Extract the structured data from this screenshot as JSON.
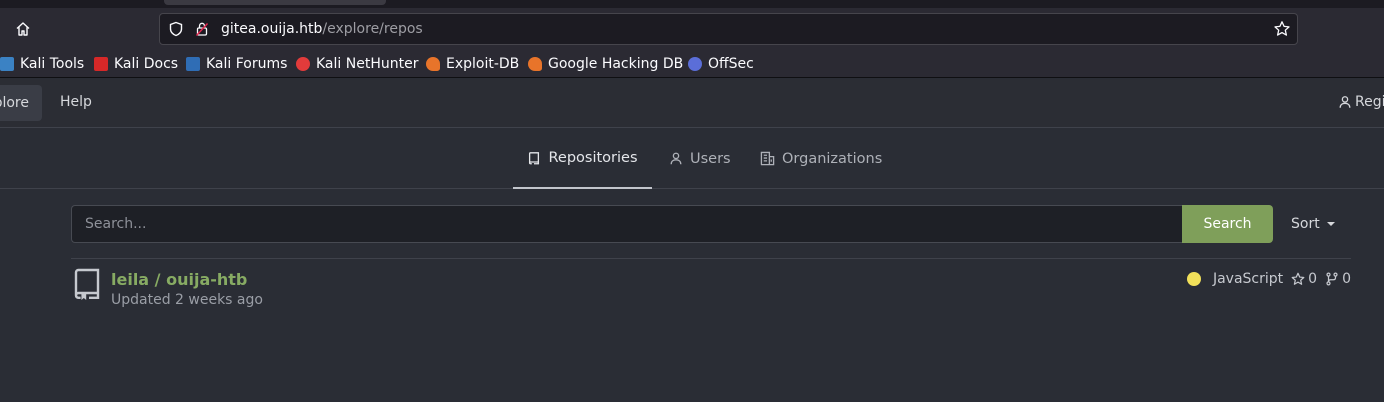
{
  "browser": {
    "url_host": "gitea.ouija.htb",
    "url_path": "/explore/repos",
    "bookmarks": [
      {
        "label": "Kali Tools",
        "color": "#3b82c4"
      },
      {
        "label": "Kali Docs",
        "color": "#d62828"
      },
      {
        "label": "Kali Forums",
        "color": "#2f6db5"
      },
      {
        "label": "Kali NetHunter",
        "color": "#e23b3b"
      },
      {
        "label": "Exploit-DB",
        "color": "#e8742a"
      },
      {
        "label": "Google Hacking DB",
        "color": "#e8742a"
      },
      {
        "label": "OffSec",
        "color": "#5b6ed8"
      }
    ]
  },
  "gitea": {
    "nav": {
      "explore": "Explore",
      "help": "Help",
      "register": "Register"
    },
    "tabs": [
      {
        "label": "Repositories",
        "icon": "repo-icon"
      },
      {
        "label": "Users",
        "icon": "person-icon"
      },
      {
        "label": "Organizations",
        "icon": "organization-icon"
      }
    ],
    "search": {
      "placeholder": "Search...",
      "button": "Search",
      "sort": "Sort"
    },
    "repos": [
      {
        "name": "leila / ouija-htb",
        "updated": "Updated 2 weeks ago",
        "language": "JavaScript",
        "language_color": "#f1e05a",
        "stars": "0",
        "forks": "0"
      }
    ]
  }
}
